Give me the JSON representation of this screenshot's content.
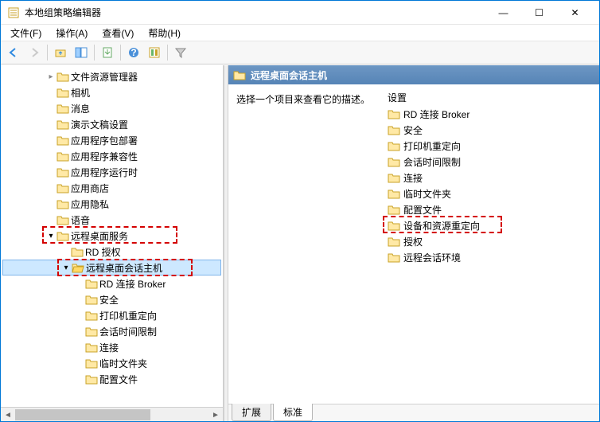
{
  "window": {
    "title": "本地组策略编辑器"
  },
  "menu": {
    "file": "文件(F)",
    "action": "操作(A)",
    "view": "查看(V)",
    "help": "帮助(H)"
  },
  "tree": {
    "items": [
      {
        "label": "文件资源管理器",
        "indent": 3,
        "toggle": "▷"
      },
      {
        "label": "相机",
        "indent": 3,
        "toggle": ""
      },
      {
        "label": "消息",
        "indent": 3,
        "toggle": ""
      },
      {
        "label": "演示文稿设置",
        "indent": 3,
        "toggle": ""
      },
      {
        "label": "应用程序包部署",
        "indent": 3,
        "toggle": ""
      },
      {
        "label": "应用程序兼容性",
        "indent": 3,
        "toggle": ""
      },
      {
        "label": "应用程序运行时",
        "indent": 3,
        "toggle": ""
      },
      {
        "label": "应用商店",
        "indent": 3,
        "toggle": ""
      },
      {
        "label": "应用隐私",
        "indent": 3,
        "toggle": ""
      },
      {
        "label": "语音",
        "indent": 3,
        "toggle": ""
      },
      {
        "label": "远程桌面服务",
        "indent": 3,
        "toggle": "▽",
        "box": true
      },
      {
        "label": "RD 授权",
        "indent": 4,
        "toggle": ""
      },
      {
        "label": "远程桌面会话主机",
        "indent": 4,
        "toggle": "▽",
        "box": true,
        "selected": true,
        "open": true
      },
      {
        "label": "RD 连接 Broker",
        "indent": 5,
        "toggle": ""
      },
      {
        "label": "安全",
        "indent": 5,
        "toggle": ""
      },
      {
        "label": "打印机重定向",
        "indent": 5,
        "toggle": ""
      },
      {
        "label": "会话时间限制",
        "indent": 5,
        "toggle": ""
      },
      {
        "label": "连接",
        "indent": 5,
        "toggle": ""
      },
      {
        "label": "临时文件夹",
        "indent": 5,
        "toggle": ""
      },
      {
        "label": "配置文件",
        "indent": 5,
        "toggle": ""
      }
    ]
  },
  "right": {
    "header": "远程桌面会话主机",
    "description": "选择一个项目来查看它的描述。",
    "list_header": "设置",
    "items": [
      {
        "label": "RD 连接 Broker"
      },
      {
        "label": "安全"
      },
      {
        "label": "打印机重定向"
      },
      {
        "label": "会话时间限制"
      },
      {
        "label": "连接"
      },
      {
        "label": "临时文件夹"
      },
      {
        "label": "配置文件"
      },
      {
        "label": "设备和资源重定向",
        "box": true
      },
      {
        "label": "授权"
      },
      {
        "label": "远程会话环境"
      }
    ]
  },
  "tabs": {
    "extended": "扩展",
    "standard": "标准"
  },
  "icons": {
    "app": "app-icon",
    "back": "◄",
    "forward": "►",
    "up": "▲",
    "minimize": "—",
    "maximize": "☐",
    "close": "✕"
  },
  "colors": {
    "highlight_border": "#d40000",
    "header_bg": "#5684b6",
    "selection": "#cde8ff"
  }
}
